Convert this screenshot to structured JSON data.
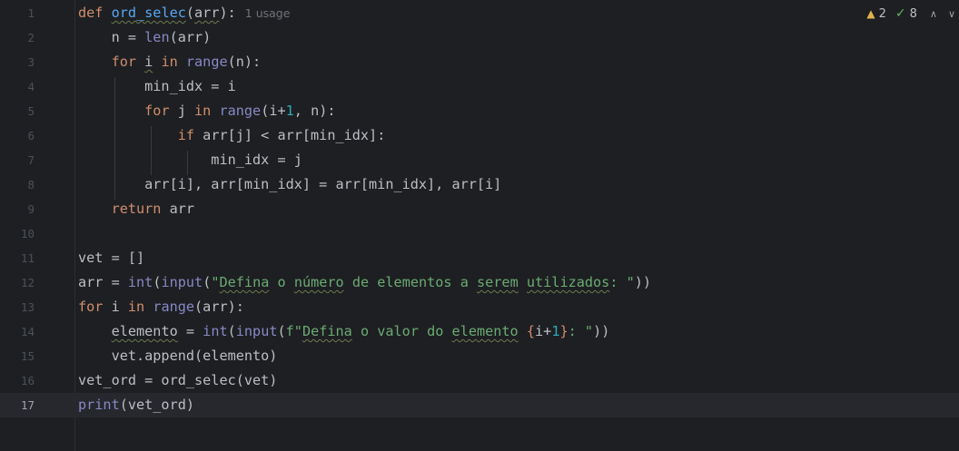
{
  "editor": {
    "lines": [
      {
        "n": "1",
        "guides": [],
        "tokens": [
          {
            "t": "def ",
            "c": "kw"
          },
          {
            "t": "ord_selec",
            "c": "fn",
            "u": true
          },
          {
            "t": "(",
            "c": "plain"
          },
          {
            "t": "arr",
            "c": "plain",
            "u": true
          },
          {
            "t": "):",
            "c": "plain"
          }
        ],
        "usage": "1 usage"
      },
      {
        "n": "2",
        "guides": [],
        "tokens": [
          {
            "t": "    n = ",
            "c": "plain"
          },
          {
            "t": "len",
            "c": "bi"
          },
          {
            "t": "(arr)",
            "c": "plain"
          }
        ]
      },
      {
        "n": "3",
        "guides": [],
        "tokens": [
          {
            "t": "    ",
            "c": "plain"
          },
          {
            "t": "for ",
            "c": "kw"
          },
          {
            "t": "i",
            "c": "plain",
            "u": true
          },
          {
            "t": " in ",
            "c": "kw"
          },
          {
            "t": "range",
            "c": "bi"
          },
          {
            "t": "(n):",
            "c": "plain"
          }
        ]
      },
      {
        "n": "4",
        "tokens": [
          {
            "t": "        min_idx = i",
            "c": "plain"
          }
        ]
      },
      {
        "n": "5",
        "tokens": [
          {
            "t": "        ",
            "c": "plain"
          },
          {
            "t": "for ",
            "c": "kw"
          },
          {
            "t": "j",
            "c": "plain"
          },
          {
            "t": " in ",
            "c": "kw"
          },
          {
            "t": "range",
            "c": "bi"
          },
          {
            "t": "(i+",
            "c": "plain"
          },
          {
            "t": "1",
            "c": "num"
          },
          {
            "t": ", n):",
            "c": "plain"
          }
        ]
      },
      {
        "n": "6",
        "tokens": [
          {
            "t": "            ",
            "c": "plain"
          },
          {
            "t": "if ",
            "c": "kw"
          },
          {
            "t": "arr[j] < arr[min_idx]:",
            "c": "plain"
          }
        ]
      },
      {
        "n": "7",
        "tokens": [
          {
            "t": "                min_idx = j",
            "c": "plain"
          }
        ]
      },
      {
        "n": "8",
        "tokens": [
          {
            "t": "        arr[i], arr[min_idx] = arr[min_idx], arr[i]",
            "c": "plain"
          }
        ]
      },
      {
        "n": "9",
        "tokens": [
          {
            "t": "    ",
            "c": "plain"
          },
          {
            "t": "return ",
            "c": "kw"
          },
          {
            "t": "arr",
            "c": "plain"
          }
        ]
      },
      {
        "n": "10",
        "tokens": []
      },
      {
        "n": "11",
        "tokens": [
          {
            "t": "vet = []",
            "c": "plain"
          }
        ]
      },
      {
        "n": "12",
        "tokens": [
          {
            "t": "arr = ",
            "c": "plain"
          },
          {
            "t": "int",
            "c": "bi"
          },
          {
            "t": "(",
            "c": "plain"
          },
          {
            "t": "input",
            "c": "bi"
          },
          {
            "t": "(",
            "c": "plain"
          },
          {
            "t": "\"",
            "c": "str"
          },
          {
            "t": "Defina",
            "c": "str",
            "u": true
          },
          {
            "t": " o ",
            "c": "str"
          },
          {
            "t": "número",
            "c": "str",
            "u": true
          },
          {
            "t": " de elementos a ",
            "c": "str"
          },
          {
            "t": "serem",
            "c": "str",
            "u": true
          },
          {
            "t": " ",
            "c": "str"
          },
          {
            "t": "utilizados",
            "c": "str",
            "u": true
          },
          {
            "t": ": \"",
            "c": "str"
          },
          {
            "t": "))",
            "c": "plain"
          }
        ]
      },
      {
        "n": "13",
        "tokens": [
          {
            "t": "for ",
            "c": "kw"
          },
          {
            "t": "i",
            "c": "plain"
          },
          {
            "t": " in ",
            "c": "kw"
          },
          {
            "t": "range",
            "c": "bi"
          },
          {
            "t": "(arr):",
            "c": "plain"
          }
        ]
      },
      {
        "n": "14",
        "tokens": [
          {
            "t": "    ",
            "c": "plain"
          },
          {
            "t": "elemento",
            "c": "plain",
            "u": true
          },
          {
            "t": " = ",
            "c": "plain"
          },
          {
            "t": "int",
            "c": "bi"
          },
          {
            "t": "(",
            "c": "plain"
          },
          {
            "t": "input",
            "c": "bi"
          },
          {
            "t": "(",
            "c": "plain"
          },
          {
            "t": "f\"",
            "c": "str"
          },
          {
            "t": "Defina",
            "c": "str",
            "u": true
          },
          {
            "t": " o valor do ",
            "c": "str"
          },
          {
            "t": "elemento",
            "c": "str",
            "u": true
          },
          {
            "t": " ",
            "c": "str"
          },
          {
            "t": "{",
            "c": "brace"
          },
          {
            "t": "i+",
            "c": "plain"
          },
          {
            "t": "1",
            "c": "num"
          },
          {
            "t": "}",
            "c": "brace"
          },
          {
            "t": ": \"",
            "c": "str"
          },
          {
            "t": "))",
            "c": "plain"
          }
        ]
      },
      {
        "n": "15",
        "tokens": [
          {
            "t": "    vet.append(elemento)",
            "c": "plain"
          }
        ]
      },
      {
        "n": "16",
        "tokens": [
          {
            "t": "vet_ord = ord_selec(vet)",
            "c": "plain"
          }
        ]
      },
      {
        "n": "17",
        "current": true,
        "tokens": [
          {
            "t": "print",
            "c": "bi"
          },
          {
            "t": "(vet_ord)",
            "c": "plain"
          }
        ]
      }
    ]
  },
  "inspections": {
    "warnings_icon": "warning-triangle-icon",
    "warnings_count": "2",
    "weak_icon": "double-check-icon",
    "weak_count": "8",
    "up_icon": "chevron-up-icon",
    "down_icon": "chevron-down-icon"
  },
  "colors": {
    "background": "#1e1f22",
    "keyword": "#cf8e6d",
    "function": "#56a8f5",
    "builtin": "#8888c6",
    "string": "#6aab73",
    "number": "#2aacb8"
  }
}
